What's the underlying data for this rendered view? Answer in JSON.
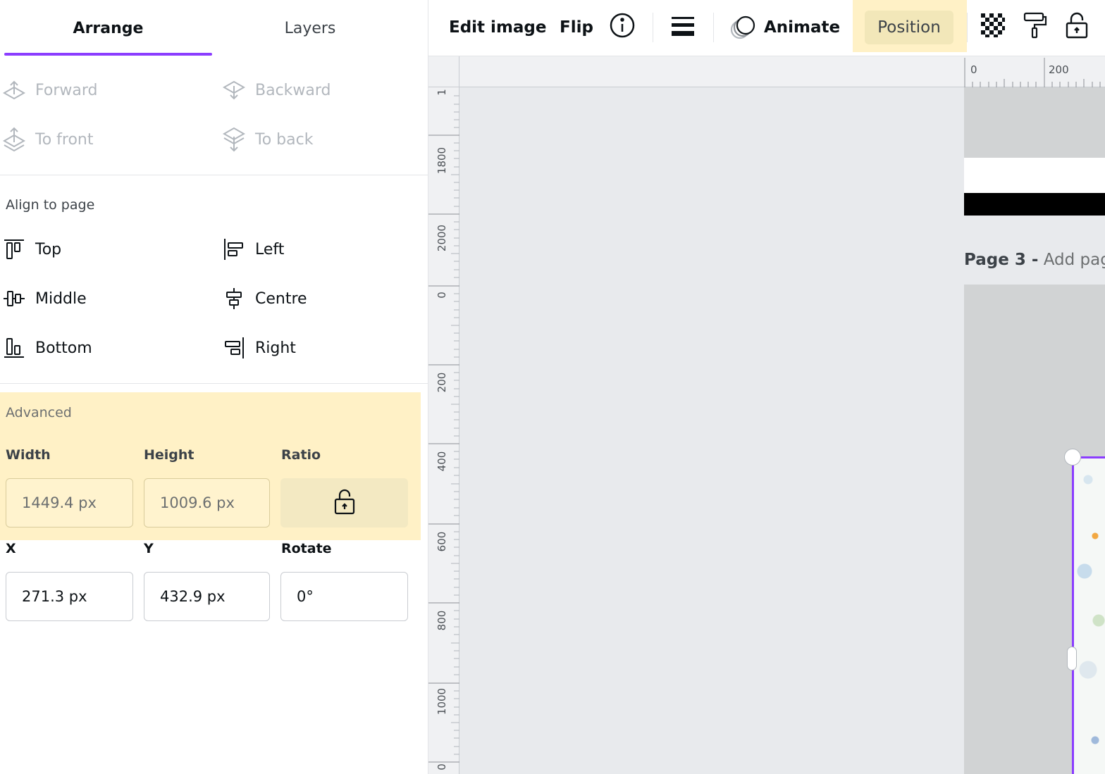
{
  "panel": {
    "tabs": [
      {
        "label": "Arrange",
        "active": true
      },
      {
        "label": "Layers",
        "active": false
      }
    ],
    "order": {
      "forward": "Forward",
      "backward": "Backward",
      "to_front": "To front",
      "to_back": "To back"
    },
    "align": {
      "heading": "Align to page",
      "top": "Top",
      "left": "Left",
      "middle": "Middle",
      "centre": "Centre",
      "bottom": "Bottom",
      "right": "Right"
    },
    "advanced": {
      "heading": "Advanced",
      "width_label": "Width",
      "height_label": "Height",
      "ratio_label": "Ratio",
      "width_value": "1449.4 px",
      "height_value": "1009.6 px",
      "x_label": "X",
      "y_label": "Y",
      "rotate_label": "Rotate",
      "x_value": "271.3 px",
      "y_value": "432.9 px",
      "rotate_value": "0°"
    }
  },
  "toolbar": {
    "edit_image": "Edit image",
    "flip": "Flip",
    "animate": "Animate",
    "position": "Position",
    "icons": [
      "info-icon",
      "border-style-icon",
      "animate-icon",
      "transparency-icon",
      "paint-roller-icon",
      "lock-icon"
    ]
  },
  "canvas": {
    "ruler_top": [
      "0",
      "200"
    ],
    "ruler_left": [
      "1",
      "1800",
      "2000",
      "0",
      "200",
      "400",
      "600",
      "800",
      "1000",
      "0"
    ],
    "page_label_name": "Page 3 -",
    "page_label_add": "Add page title",
    "accent_color": "#8b3dff"
  }
}
